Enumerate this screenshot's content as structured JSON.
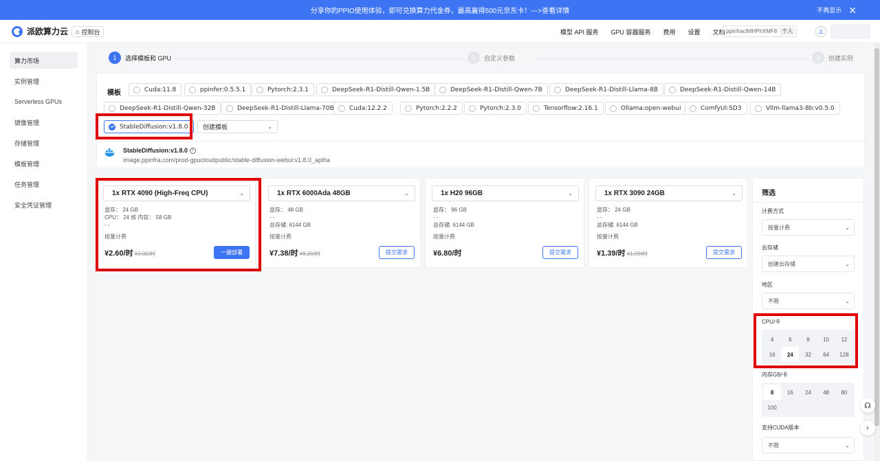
{
  "banner": {
    "message": "分享你的PPIO使用体验，即可兑换算力代金券，最高赢得500元京东卡！--->查看详情",
    "dismiss_label": "不再显示",
    "close_glyph": "✕"
  },
  "header": {
    "brand": "派欧算力云",
    "console_label": "控制台",
    "nav": [
      "模型 API 服务",
      "GPU 容器服务",
      "费用",
      "设置",
      "文档"
    ],
    "account_id": "ppinfracIMHPhXMF8",
    "account_type": "个人",
    "account_switch_glyph": "⇄",
    "avatar_glyph": "♙"
  },
  "sidebar": {
    "items": [
      "算力市场",
      "实例管理",
      "Serverless GPUs",
      "镜像管理",
      "存储管理",
      "模板管理",
      "任务管理",
      "安全凭证管理"
    ],
    "active_index": 0
  },
  "stepper": {
    "steps": [
      {
        "num": "1",
        "label": "选择模板和 GPU"
      },
      {
        "num": "2",
        "label": "自定义参数"
      },
      {
        "num": "3",
        "label": "创建实例"
      }
    ],
    "active_index": 0
  },
  "templates": {
    "label": "模板",
    "chips": [
      "Cuda:11.8",
      "ppinfer:0.5.5.1",
      "Pytorch:2.3.1",
      "DeepSeek-R1-Distill-Qwen-1.5B",
      "DeepSeek-R1-Distill-Qwen-7B",
      "DeepSeek-R1-Distill-Llama-8B",
      "DeepSeek-R1-Distill-Qwen-14B",
      "DeepSeek-R1-Distill-Qwen-32B",
      "DeepSeek-R1-Distill-Llama-70B",
      "Cuda:12.2.2",
      "Pytorch:2.2.2",
      "Pytorch:2.3.0",
      "Tensorflow:2.16.1",
      "Ollama:open-webui",
      "ComfyUI:SD3",
      "Vllm-llama3-8b:v0.5.0",
      "StableDiffusion:v1.8.0"
    ],
    "selected": "StableDiffusion:v1.8.0",
    "create_label": "创建模板",
    "caret_glyph": "⌄",
    "image_name": "StableDiffusion:v1.8.0",
    "image_info_glyph": "i",
    "image_url": "image.ppinfra.com/prod-gpucloudpublic/stable-diffusion-webui:v1.8.0_aplha"
  },
  "gpus": [
    {
      "name": "1x RTX 4090 (High-Freq CPU)",
      "line1": "显存： 24 GB",
      "line2": "CPU： 24 核 内存： 58 GB",
      "line3": "- -",
      "billing": "按量计费",
      "price": "¥2.60/时",
      "old_price": "¥3.00/时",
      "action": "一键部署",
      "primary": true
    },
    {
      "name": "1x RTX 6000Ada 48GB",
      "line1": "显存： 48 GB",
      "line2": "- -",
      "line3": "总存储: 6144 GB",
      "billing": "按量计费",
      "price": "¥7.38/时",
      "old_price": "¥8.20/时",
      "action": "提交需求",
      "primary": false
    },
    {
      "name": "1x H20 96GB",
      "line1": "显存： 96 GB",
      "line2": "- -",
      "line3": "总存储: 6144 GB",
      "billing": "按量计费",
      "price": "¥6.80/时",
      "old_price": "",
      "action": "提交需求",
      "primary": false
    },
    {
      "name": "1x RTX 3090 24GB",
      "line1": "显存： 24 GB",
      "line2": "- -",
      "line3": "总存储: 6144 GB",
      "billing": "按量计费",
      "price": "¥1.39/时",
      "old_price": "¥1.99/时",
      "action": "提交需求",
      "primary": false
    }
  ],
  "filter": {
    "title": "筛选",
    "billing_label": "计费方式",
    "billing_value": "按量计费",
    "storage_label": "云存储",
    "storage_value": "创建云存储",
    "region_label": "地区",
    "region_value": "不限",
    "cpu_label": "CPU/卡",
    "cpu_options": [
      "4",
      "6",
      "8",
      "10",
      "12",
      "16",
      "24",
      "32",
      "64",
      "128"
    ],
    "cpu_selected": "24",
    "mem_label": "内存GB/卡",
    "mem_options": [
      "8",
      "16",
      "24",
      "48",
      "80",
      "100"
    ],
    "mem_selected": "8",
    "cuda_label": "支持CUDA版本",
    "cuda_value": "不限"
  },
  "float": {
    "support_glyph": "☊",
    "next_glyph": "›"
  },
  "colors": {
    "accent": "#3c74f4",
    "highlight": "#e00000"
  }
}
